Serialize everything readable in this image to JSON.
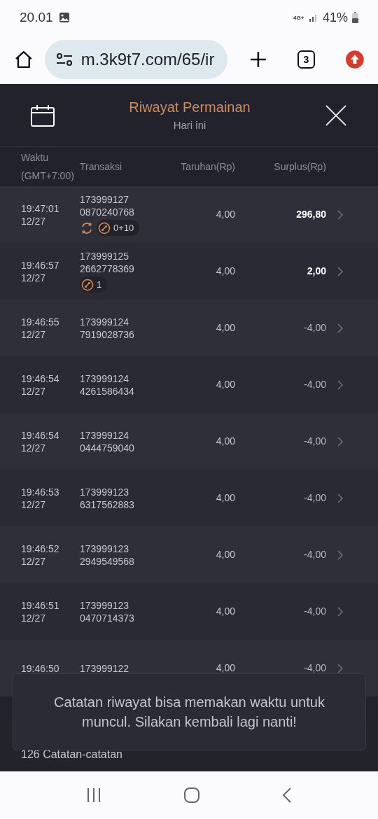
{
  "status_bar": {
    "time": "20.01",
    "network": "4G+",
    "battery": "41%"
  },
  "browser": {
    "url": "m.3k9t7.com/65/ir",
    "tab_count": "3"
  },
  "modal": {
    "title": "Riwayat Permainan",
    "subtitle": "Hari ini"
  },
  "table": {
    "columns": [
      {
        "lines": [
          "Waktu",
          "(GMT+7:00)"
        ]
      },
      {
        "lines": [
          "Transaksi"
        ]
      },
      {
        "lines": [
          "Taruhan(Rp)"
        ]
      },
      {
        "lines": [
          "Surplus(Rp)"
        ]
      }
    ],
    "rows": [
      {
        "time": [
          "19:47:01",
          "12/27"
        ],
        "transaction": [
          "173999127",
          "0870240768"
        ],
        "badges": [
          {
            "kind": "respin"
          },
          {
            "kind": "free",
            "text": "0+10"
          }
        ],
        "bet": "4,00",
        "surplus": "296,80",
        "win": true
      },
      {
        "time": [
          "19:46:57",
          "12/27"
        ],
        "transaction": [
          "173999125",
          "2662778369"
        ],
        "badges": [
          {
            "kind": "free",
            "text": "1"
          }
        ],
        "bet": "4,00",
        "surplus": "2,00",
        "win": true
      },
      {
        "time": [
          "19:46:55",
          "12/27"
        ],
        "transaction": [
          "173999124",
          "7919028736"
        ],
        "bet": "4,00",
        "surplus": "-4,00",
        "win": false
      },
      {
        "time": [
          "19:46:54",
          "12/27"
        ],
        "transaction": [
          "173999124",
          "4261586434"
        ],
        "bet": "4,00",
        "surplus": "-4,00",
        "win": false
      },
      {
        "time": [
          "19:46:54",
          "12/27"
        ],
        "transaction": [
          "173999124",
          "0444759040"
        ],
        "bet": "4,00",
        "surplus": "-4,00",
        "win": false
      },
      {
        "time": [
          "19:46:53",
          "12/27"
        ],
        "transaction": [
          "173999123",
          "6317562883"
        ],
        "bet": "4,00",
        "surplus": "-4,00",
        "win": false
      },
      {
        "time": [
          "19:46:52",
          "12/27"
        ],
        "transaction": [
          "173999123",
          "2949549568"
        ],
        "bet": "4,00",
        "surplus": "-4,00",
        "win": false
      },
      {
        "time": [
          "19:46:51",
          "12/27"
        ],
        "transaction": [
          "173999123",
          "0470714373"
        ],
        "bet": "4,00",
        "surplus": "-4,00",
        "win": false
      },
      {
        "time": [
          "19:46:50"
        ],
        "transaction": [
          "173999122"
        ],
        "bet": "4,00",
        "surplus": "-4,00",
        "win": false
      }
    ]
  },
  "footer": {
    "count": "126 Catatan-catatan"
  },
  "toast": {
    "message": "Catatan riwayat bisa memakan waktu untuk muncul. Silakan kembali lagi nanti!"
  }
}
